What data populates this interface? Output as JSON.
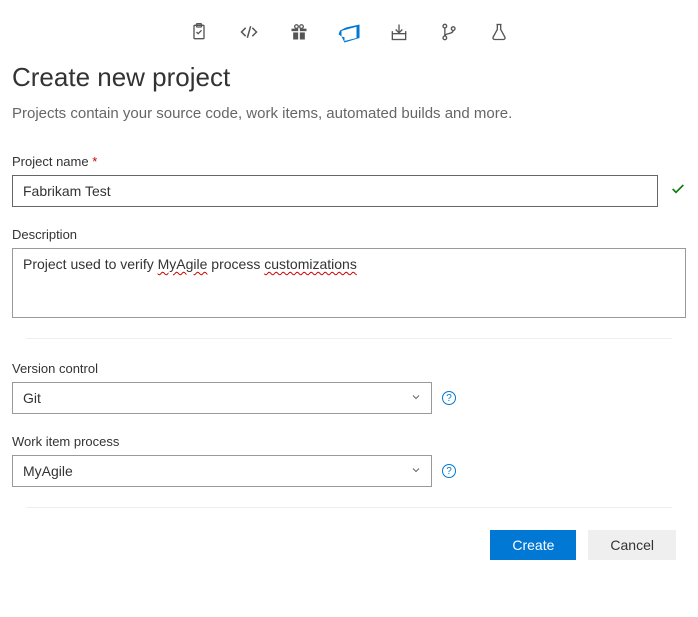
{
  "icons": {
    "clipboard": "clipboard",
    "code": "code",
    "gift": "gift",
    "devops": "azure-devops",
    "download": "download",
    "git": "git-branch",
    "flask": "flask"
  },
  "page": {
    "title": "Create new project",
    "subtitle": "Projects contain your source code, work items, automated builds and more."
  },
  "fields": {
    "project_name": {
      "label": "Project name",
      "required_mark": "*",
      "value": "Fabrikam Test",
      "valid": true
    },
    "description": {
      "label": "Description",
      "value_parts": {
        "p1": "Project used to verify ",
        "err1": "MyAgile",
        "p2": " process ",
        "err2": "customizations"
      }
    },
    "version_control": {
      "label": "Version control",
      "value": "Git"
    },
    "work_item_process": {
      "label": "Work item process",
      "value": "MyAgile"
    }
  },
  "buttons": {
    "create": "Create",
    "cancel": "Cancel"
  },
  "help": "?"
}
